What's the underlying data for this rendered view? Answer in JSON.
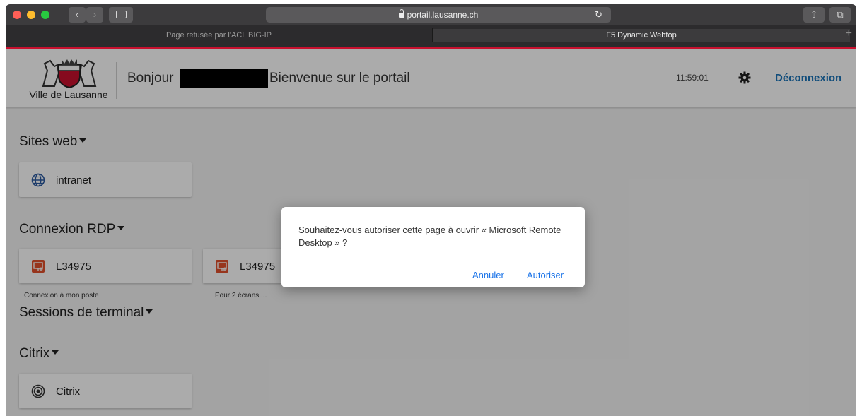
{
  "browser": {
    "url": "portail.lausanne.ch",
    "tabs": [
      {
        "label": "Page refusée par l'ACL BIG-IP",
        "active": false
      },
      {
        "label": "F5 Dynamic Webtop",
        "active": true
      }
    ],
    "new_tab_symbol": "+"
  },
  "header": {
    "logo_text": "Ville de Lausanne",
    "greeting": "Bonjour",
    "welcome": "Bienvenue sur le portail",
    "clock": "11:59:01",
    "logout_label": "Déconnexion",
    "brand_color": "#c8102e",
    "accent_color": "#1a73b8"
  },
  "sections": {
    "web": {
      "title": "Sites web",
      "items": [
        {
          "label": "intranet",
          "icon": "globe-icon"
        }
      ]
    },
    "rdp": {
      "title": "Connexion RDP",
      "items": [
        {
          "label": "L34975",
          "description": "Connexion à mon poste",
          "icon": "remote-desktop-icon"
        },
        {
          "label": "L34975",
          "description": "Pour 2 écrans....",
          "icon": "remote-desktop-icon"
        }
      ]
    },
    "terminal": {
      "title": "Sessions de terminal"
    },
    "citrix": {
      "title": "Citrix",
      "items": [
        {
          "label": "Citrix",
          "icon": "citrix-icon"
        }
      ]
    }
  },
  "dialog": {
    "message": "Souhaitez-vous autoriser cette page à ouvrir « Microsoft Remote Desktop » ?",
    "cancel_label": "Annuler",
    "allow_label": "Autoriser"
  }
}
